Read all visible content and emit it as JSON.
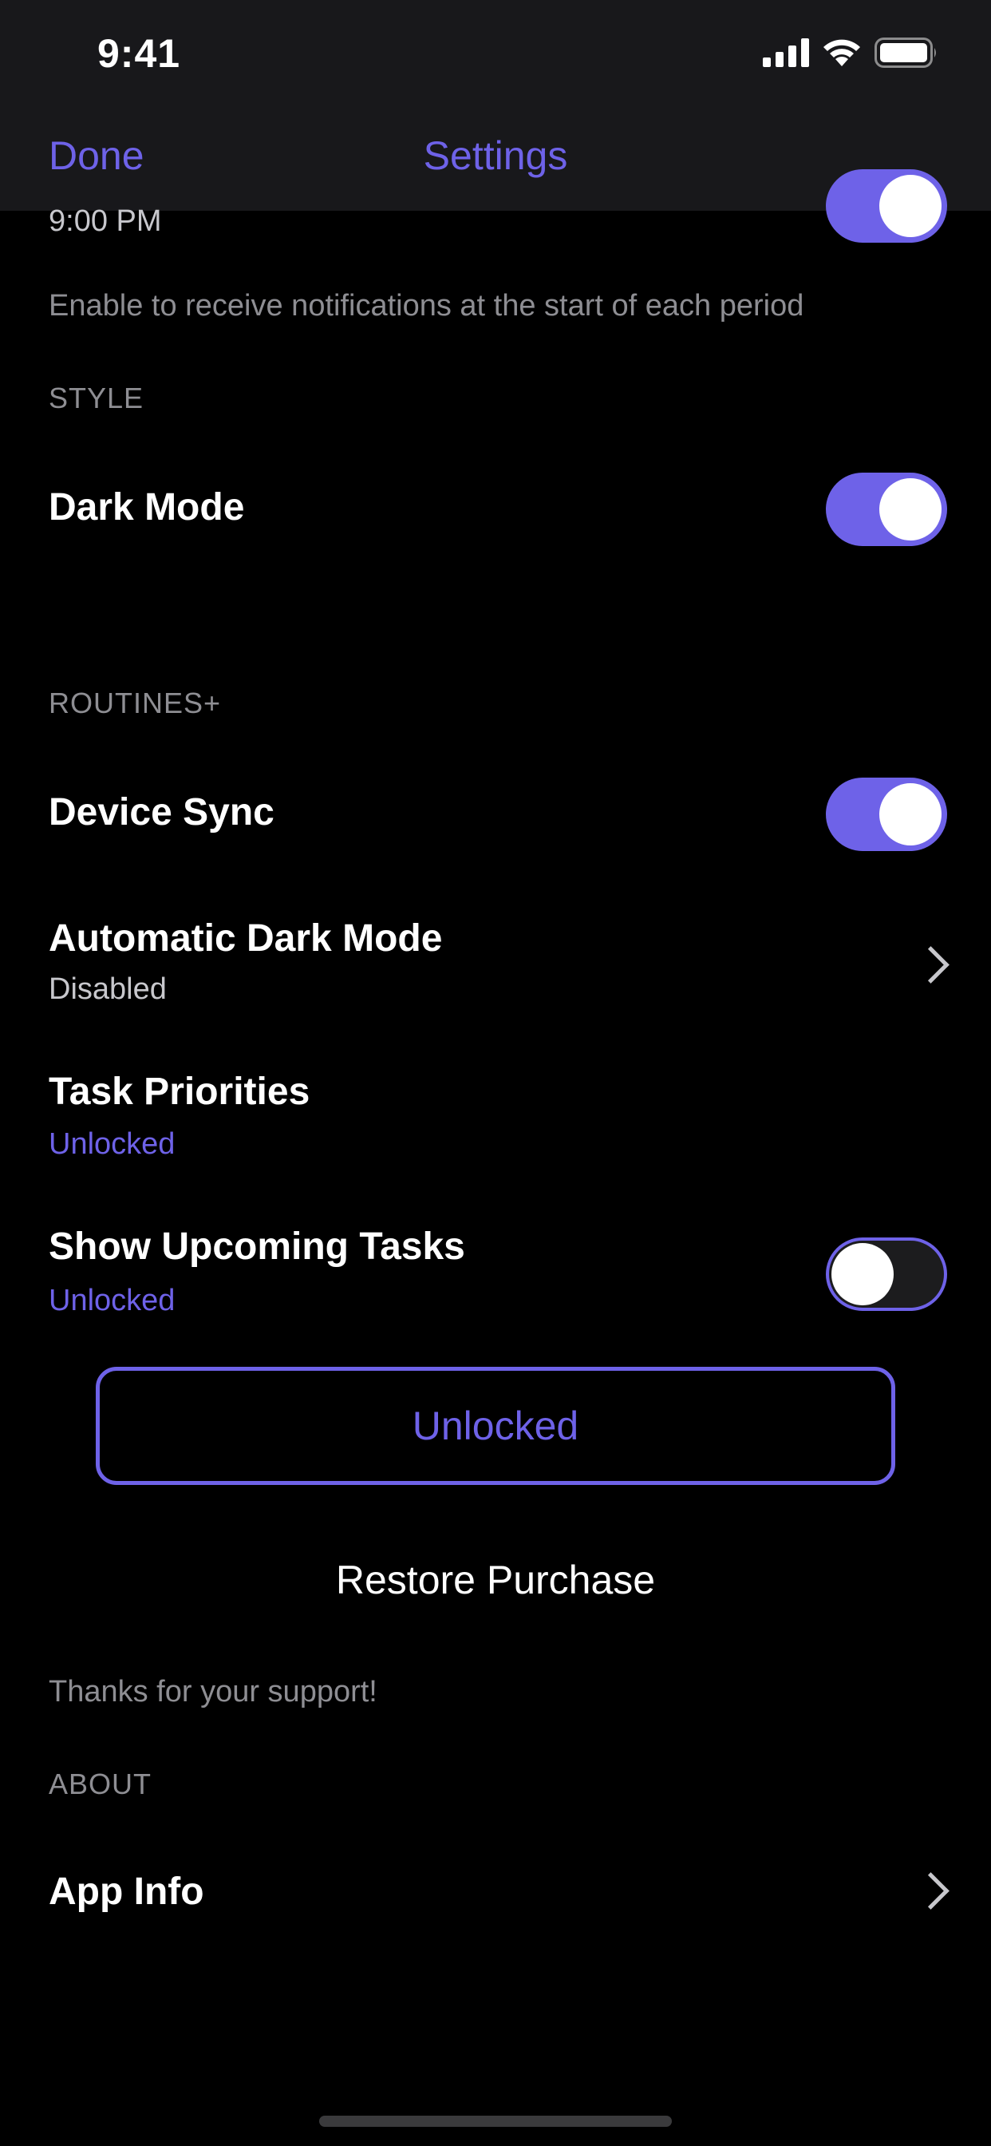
{
  "status_bar": {
    "time": "9:41",
    "icons": [
      "signal-icon",
      "wifi-icon",
      "battery-icon"
    ]
  },
  "nav": {
    "done_label": "Done",
    "title": "Settings"
  },
  "notifications": {
    "time_value": "9:00 PM",
    "toggle_on": true,
    "footer": "Enable to receive notifications at the start of each period"
  },
  "style_section": {
    "header": "STYLE",
    "dark_mode_label": "Dark Mode",
    "dark_mode_on": true
  },
  "routines_section": {
    "header": "ROUTINES+",
    "device_sync_label": "Device Sync",
    "device_sync_on": true,
    "auto_dark_label": "Automatic Dark Mode",
    "auto_dark_value": "Disabled",
    "task_priorities_label": "Task Priorities",
    "task_priorities_status": "Unlocked",
    "upcoming_label": "Show Upcoming Tasks",
    "upcoming_status": "Unlocked",
    "upcoming_on": false,
    "unlock_button_label": "Unlocked",
    "restore_label": "Restore Purchase",
    "footer": "Thanks for your support!"
  },
  "about_section": {
    "header": "ABOUT",
    "app_info_label": "App Info"
  },
  "colors": {
    "accent": "#6e62e8",
    "background": "#000000",
    "bar_background": "#18181b",
    "secondary_text": "#8e8e93"
  }
}
